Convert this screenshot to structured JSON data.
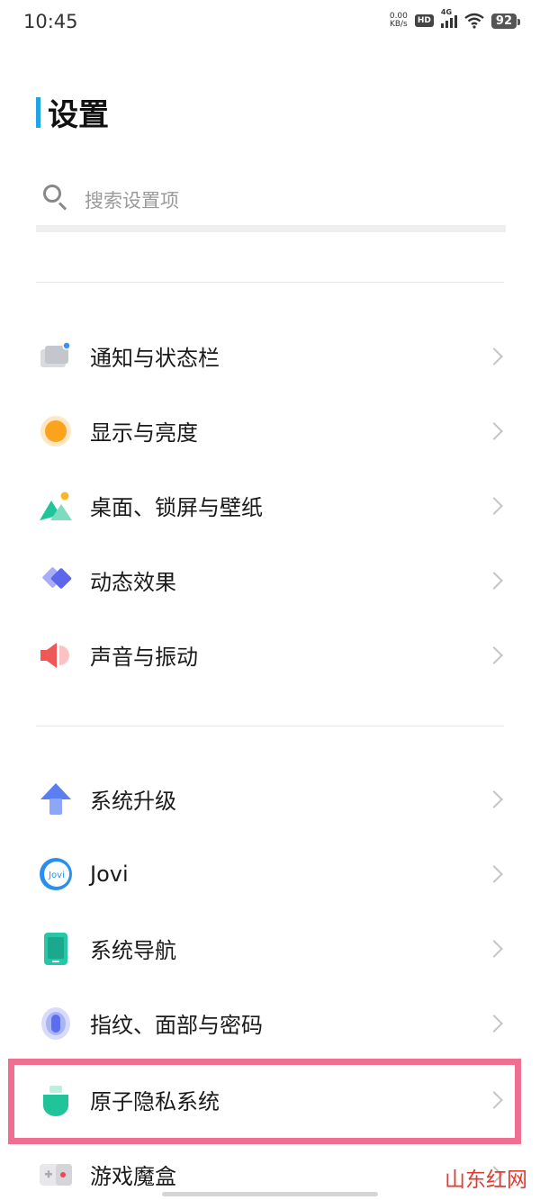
{
  "status_bar": {
    "time": "10:45",
    "net_speed_value": "0.00",
    "net_speed_unit": "KB/s",
    "hd": "HD",
    "network": "4G",
    "battery": "92"
  },
  "page": {
    "title": "设置"
  },
  "search": {
    "placeholder": "搜索设置项"
  },
  "groups": {
    "display": [
      {
        "label": "通知与状态栏",
        "icon": "notification-icon"
      },
      {
        "label": "显示与亮度",
        "icon": "brightness-icon"
      },
      {
        "label": "桌面、锁屏与壁纸",
        "icon": "wallpaper-icon"
      },
      {
        "label": "动态效果",
        "icon": "animation-icon"
      },
      {
        "label": "声音与振动",
        "icon": "sound-icon"
      }
    ],
    "system": [
      {
        "label": "系统升级",
        "icon": "upgrade-icon"
      },
      {
        "label": "Jovi",
        "icon": "jovi-icon"
      },
      {
        "label": "系统导航",
        "icon": "navigation-icon"
      },
      {
        "label": "指纹、面部与密码",
        "icon": "fingerprint-icon"
      },
      {
        "label": "原子隐私系统",
        "icon": "privacy-icon"
      },
      {
        "label": "游戏魔盒",
        "icon": "game-box-icon"
      }
    ]
  },
  "watermark": "山东红网",
  "colors": {
    "accent": "#21a3e8",
    "highlight_border": "#ee6f92",
    "watermark": "#e23a2e"
  }
}
